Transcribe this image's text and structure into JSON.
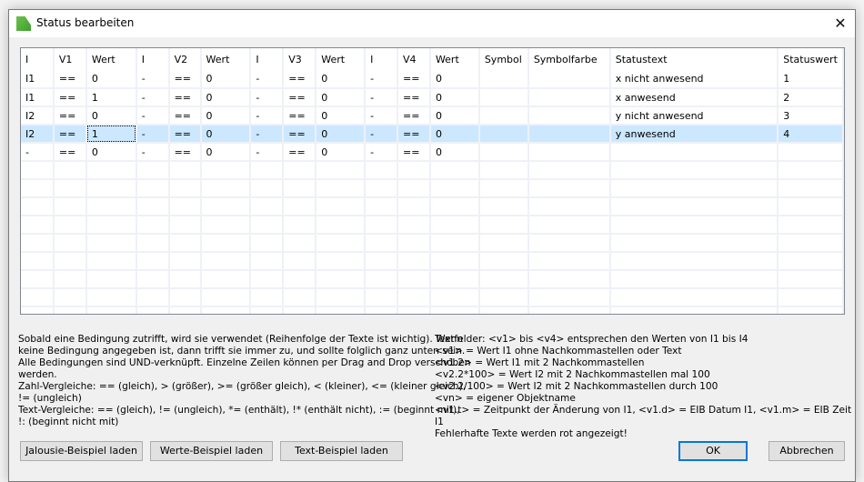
{
  "window": {
    "title": "Status bearbeiten",
    "close_icon": "close-icon",
    "app_icon": "config-icon"
  },
  "table": {
    "headers": [
      "I",
      "V1",
      "Wert",
      "I",
      "V2",
      "Wert",
      "I",
      "V3",
      "Wert",
      "I",
      "V4",
      "Wert",
      "Symbol",
      "Symbolfarbe",
      "Statustext",
      "Statuswert"
    ],
    "rows": [
      [
        "I1",
        "==",
        "0",
        "-",
        "==",
        "0",
        "-",
        "==",
        "0",
        "-",
        "==",
        "0",
        "",
        "",
        "x nicht anwesend",
        "1"
      ],
      [
        "I1",
        "==",
        "1",
        "-",
        "==",
        "0",
        "-",
        "==",
        "0",
        "-",
        "==",
        "0",
        "",
        "",
        "x anwesend",
        "2"
      ],
      [
        "I2",
        "==",
        "0",
        "-",
        "==",
        "0",
        "-",
        "==",
        "0",
        "-",
        "==",
        "0",
        "",
        "",
        "y nicht anwesend",
        "3"
      ],
      [
        "I2",
        "==",
        "1",
        "-",
        "==",
        "0",
        "-",
        "==",
        "0",
        "-",
        "==",
        "0",
        "",
        "",
        "y anwesend",
        "4"
      ],
      [
        "-",
        "==",
        "0",
        "-",
        "==",
        "0",
        "-",
        "==",
        "0",
        "-",
        "==",
        "0",
        "",
        "",
        "",
        ""
      ]
    ],
    "selected_row": 3
  },
  "help_left": [
    "Sobald eine Bedingung zutrifft, wird sie verwendet (Reihenfolge der Texte ist wichtig). Wenn",
    "keine Bedingung angegeben ist, dann trifft sie immer zu, und sollte folglich ganz unten sein.",
    "Alle Bedingungen sind UND-verknüpft. Einzelne Zeilen können per Drag and Drop verschoben",
    "werden.",
    "Zahl-Vergleiche: == (gleich), > (größer), >= (größer gleich), < (kleiner), <= (kleiner gleich),",
    "!= (ungleich)",
    "Text-Vergleiche: == (gleich), != (ungleich), *= (enthält), !* (enthält nicht), := (beginnt mit),",
    "!: (beginnt nicht mit)"
  ],
  "help_right": [
    "Textfelder: <v1> bis <v4> entsprechen den Werten von I1 bis I4",
    "<v1> = Wert I1 ohne Nachkommastellen oder Text",
    "<v1.2> = Wert I1 mit 2 Nachkommastellen",
    "<v2.2*100> = Wert I2 mit 2 Nachkommastellen mal 100",
    "<v2.2/100> = Wert I2 mit 2 Nachkommastellen durch 100",
    "<vn> = eigener Objektname",
    "<v1.t> = Zeitpunkt der Änderung von I1, <v1.d> = EIB Datum I1, <v1.m> = EIB Zeit I1",
    "Fehlerhafte Texte werden rot angezeigt!"
  ],
  "buttons": {
    "jalousie": "Jalousie-Beispiel laden",
    "werte": "Werte-Beispiel laden",
    "text": "Text-Beispiel laden",
    "ok": "OK",
    "cancel": "Abbrechen"
  },
  "colors": {
    "selection": "#cce8ff",
    "accent": "#0078d7"
  }
}
